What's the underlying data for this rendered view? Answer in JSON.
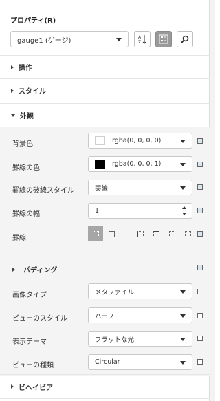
{
  "panel": {
    "title": "プロパティ(R)",
    "selected_object": "gauge1 (ゲージ)"
  },
  "toolbar": {
    "sort_icon": "sort-az-icon",
    "categorized_icon": "categorized-view-icon",
    "search_icon": "search-icon"
  },
  "sections": {
    "operation": "操作",
    "style": "スタイル",
    "appearance": "外観",
    "padding": "パディング",
    "behavior": "ビヘイビア"
  },
  "appearance": {
    "background_color": {
      "label": "背景色",
      "value": "rgba(0, 0, 0, 0)",
      "swatch": "#ffffff"
    },
    "border_color": {
      "label": "罫線の色",
      "value": "rgba(0, 0, 0, 1)",
      "swatch": "#000000"
    },
    "border_dash_style": {
      "label": "罫線の破線スタイル",
      "value": "実線"
    },
    "border_width": {
      "label": "罫線の幅",
      "value": "1"
    },
    "border": {
      "label": "罫線"
    }
  },
  "properties": {
    "image_type": {
      "label": "画像タイプ",
      "value": "メタファイル"
    },
    "view_style": {
      "label": "ビューのスタイル",
      "value": "ハーフ"
    },
    "display_theme": {
      "label": "表示テーマ",
      "value": "フラットな光"
    },
    "view_type": {
      "label": "ビューの種類",
      "value": "Circular"
    }
  },
  "colors": {
    "accent_box": "#d8e8ee",
    "selected_border_button": "#a6a6a6",
    "group_background": "#f4f4f4"
  }
}
